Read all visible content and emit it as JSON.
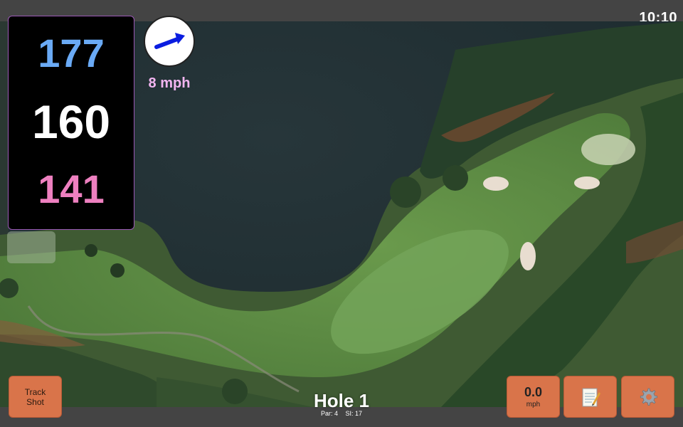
{
  "status_bar": {
    "time": "10:10"
  },
  "distances": {
    "back": "177",
    "center": "160",
    "front": "141"
  },
  "wind": {
    "speed": "8 mph",
    "direction_icon": "arrow-right-icon",
    "arrow_color": "#0a1de0"
  },
  "buttons": {
    "track_shot": {
      "line1": "Track",
      "line2": "Shot"
    },
    "speed": {
      "value": "0.0",
      "unit": "mph"
    },
    "notes": {
      "icon": "notepad-icon"
    },
    "settings": {
      "icon": "gear-icon"
    }
  },
  "hole": {
    "title": "Hole 1",
    "par": "Par: 4",
    "si": "SI: 17"
  },
  "colors": {
    "accent_orange": "#d9744a",
    "back_distance": "#6aaaf5",
    "center_distance": "#ffffff",
    "front_distance": "#ee80c0",
    "wind_text": "#f2b5f0"
  }
}
